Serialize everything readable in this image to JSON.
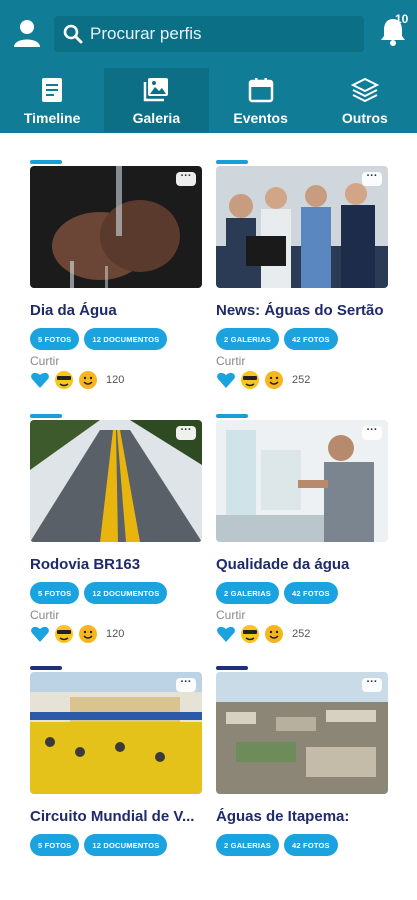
{
  "colors": {
    "header": "#107c95",
    "accent_blue": "#1a9ed6",
    "accent_dark": "#1f2f7a",
    "title": "#1f2a6b",
    "pill": "#1aa3df"
  },
  "header": {
    "search_placeholder": "Procurar perfis",
    "notifications_count": "10",
    "user_icon": "user-icon",
    "bell_icon": "bell-icon"
  },
  "tabs": [
    {
      "label": "Timeline",
      "icon": "document-icon",
      "active": false
    },
    {
      "label": "Galeria",
      "icon": "image-icon",
      "active": true
    },
    {
      "label": "Eventos",
      "icon": "calendar-icon",
      "active": false
    },
    {
      "label": "Outros",
      "icon": "layers-icon",
      "active": false
    }
  ],
  "cards": [
    {
      "title": "Dia da Água",
      "tags": [
        "5 FOTOS",
        "12 DOCUMENTOS"
      ],
      "like_label": "Curtir",
      "count": "120",
      "accent": "blue"
    },
    {
      "title": "News: Águas do Sertão",
      "tags": [
        "2 GALERIAS",
        "42 FOTOS"
      ],
      "like_label": "Curtir",
      "count": "252",
      "accent": "blue"
    },
    {
      "title": "Rodovia BR163",
      "tags": [
        "5 FOTOS",
        "12 DOCUMENTOS"
      ],
      "like_label": "Curtir",
      "count": "120",
      "accent": "blue"
    },
    {
      "title": "Qualidade da água",
      "tags": [
        "2 GALERIAS",
        "42 FOTOS"
      ],
      "like_label": "Curtir",
      "count": "252",
      "accent": "blue"
    },
    {
      "title": "Circuito Mundial de V...",
      "tags": [
        "5 FOTOS",
        "12 DOCUMENTOS"
      ],
      "accent": "dark"
    },
    {
      "title": "Águas de Itapema:",
      "tags": [
        "2 GALERIAS",
        "42 FOTOS"
      ],
      "accent": "dark"
    }
  ]
}
